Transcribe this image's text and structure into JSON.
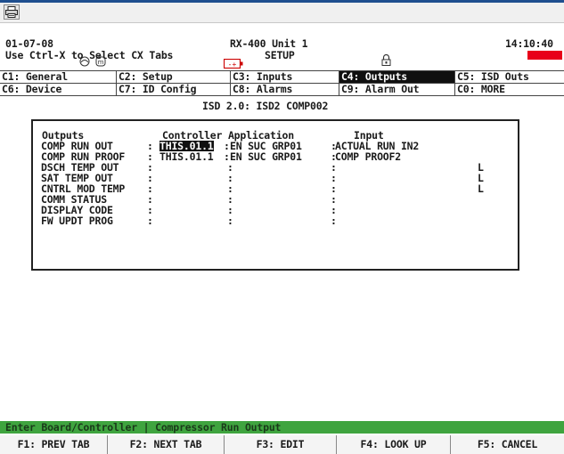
{
  "header": {
    "date": "01-07-08",
    "hint": "Use Ctrl-X to Select CX Tabs",
    "unit_name": "RX-400 Unit 1",
    "mode": "SETUP",
    "time": "14:10:40"
  },
  "tabs_row1": [
    {
      "label": "C1: General"
    },
    {
      "label": "C2: Setup"
    },
    {
      "label": "C3: Inputs"
    },
    {
      "label": "C4: Outputs"
    },
    {
      "label": "C5: ISD Outs"
    }
  ],
  "tabs_row2": [
    {
      "label": "C6: Device"
    },
    {
      "label": "C7: ID Config"
    },
    {
      "label": "C8: Alarms"
    },
    {
      "label": "C9: Alarm Out"
    },
    {
      "label": "C0: MORE"
    }
  ],
  "page_title": "ISD 2.0: ISD2 COMP002",
  "outputs": {
    "header_outputs": "Outputs",
    "header_controller_app": "Controller  Application",
    "header_input": "Input",
    "rows": [
      {
        "name": "COMP RUN OUT",
        "controller": "THIS.01.1",
        "application": "EN SUC GRP01",
        "input": "ACTUAL RUN IN2",
        "flag": ""
      },
      {
        "name": "COMP RUN PROOF",
        "controller": "THIS.01.1",
        "application": "EN SUC GRP01",
        "input": "COMP PROOF2",
        "flag": ""
      },
      {
        "name": "DSCH TEMP OUT",
        "controller": "",
        "application": "",
        "input": "",
        "flag": "L"
      },
      {
        "name": "SAT TEMP OUT",
        "controller": "",
        "application": "",
        "input": "",
        "flag": "L"
      },
      {
        "name": "CNTRL MOD TEMP",
        "controller": "",
        "application": "",
        "input": "",
        "flag": "L"
      },
      {
        "name": "COMM STATUS",
        "controller": "",
        "application": "",
        "input": "",
        "flag": ""
      },
      {
        "name": "DISPLAY CODE",
        "controller": "",
        "application": "",
        "input": "",
        "flag": ""
      },
      {
        "name": "FW UPDT PROG",
        "controller": "",
        "application": "",
        "input": "",
        "flag": ""
      }
    ]
  },
  "help_text": "Enter Board/Controller | Compressor Run Output",
  "function_keys": [
    {
      "label": "F1: PREV TAB"
    },
    {
      "label": "F2: NEXT TAB"
    },
    {
      "label": "F3: EDIT"
    },
    {
      "label": "F4: LOOK UP"
    },
    {
      "label": "F5: CANCEL"
    }
  ],
  "colors": {
    "help_bar": "#3fa43f",
    "alarm": "#e8001a",
    "active_tab_bg": "#101010"
  }
}
